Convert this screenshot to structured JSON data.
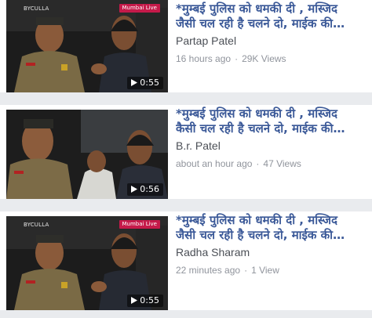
{
  "videos": [
    {
      "title_line1": "*मुम्बई पुलिस को धमकी दी , मस्जिद",
      "title_line2": "जैसी चल रही है चलने दो, माईक की…",
      "author": "Partap Patel",
      "time": "16 hours ago",
      "views": "29K Views",
      "duration": "0:55",
      "location_tag": "BYCULLA",
      "brand": "Mumbai Live"
    },
    {
      "title_line1": "*मुम्बई पुलिस को धमकी दी , मस्जिद",
      "title_line2": "कैसी चल रही है चलने दो, माईक की…",
      "author": "B.r. Patel",
      "time": "about an hour ago",
      "views": "47 Views",
      "duration": "0:56",
      "location_tag": "",
      "brand": ""
    },
    {
      "title_line1": "*मुम्बई पुलिस को धमकी दी , मस्जिद",
      "title_line2": "जैसी चल रही है चलने दो, माईक की…",
      "author": "Radha Sharam",
      "time": "22 minutes ago",
      "views": "1 View",
      "duration": "0:55",
      "location_tag": "BYCULLA",
      "brand": "Mumbai Live"
    }
  ],
  "separator": "·",
  "colors": {
    "title": "#3b5998",
    "meta": "#90949c",
    "author": "#4b4f56",
    "background": "#e9ebee"
  }
}
